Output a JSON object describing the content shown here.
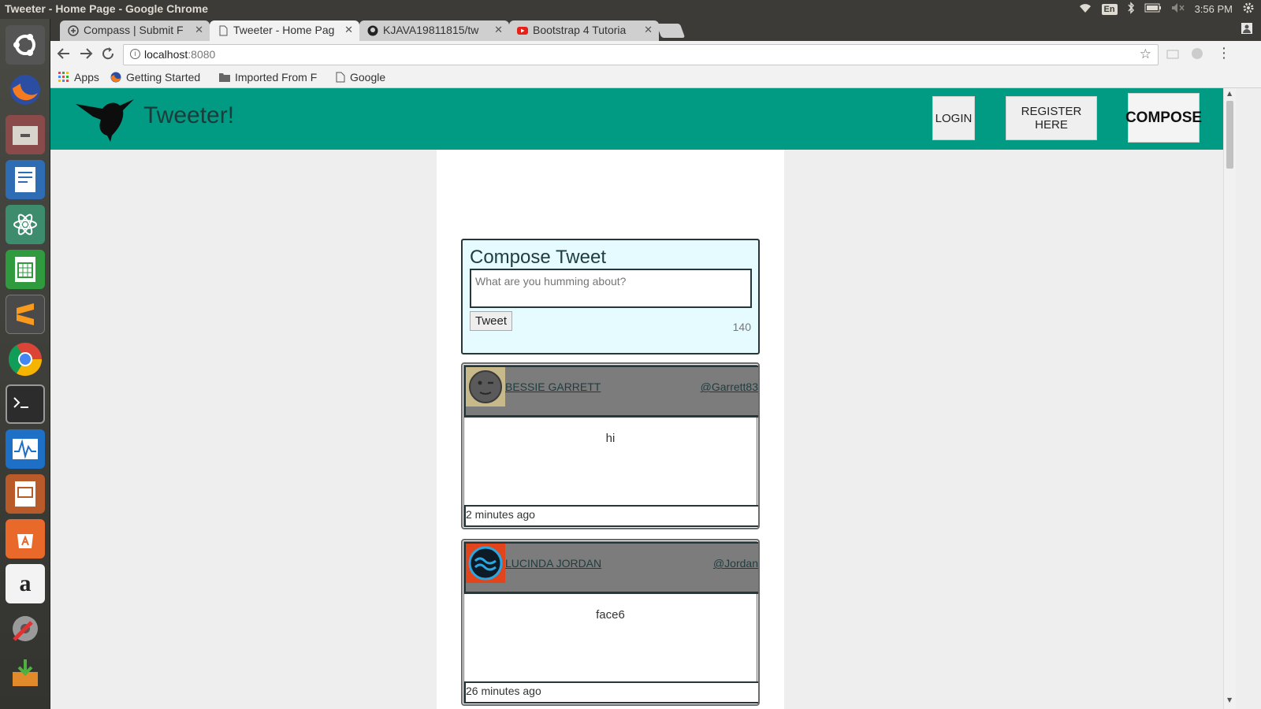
{
  "os": {
    "window_title": "Tweeter - Home Page - Google Chrome",
    "keyboard_layout": "En",
    "clock": "3:56 PM"
  },
  "launcher": {
    "icons": [
      "ubuntu-dash-icon",
      "firefox-icon",
      "files-icon",
      "writer-icon",
      "atom-icon",
      "calc-icon",
      "sublime-icon",
      "chrome-icon",
      "terminal-icon",
      "system-monitor-icon",
      "impress-icon",
      "software-center-icon",
      "amazon-icon",
      "settings-icon",
      "installer-icon"
    ]
  },
  "browser": {
    "tabs": [
      {
        "label": "Compass | Submit F",
        "active": false
      },
      {
        "label": "Tweeter - Home Pag",
        "active": true
      },
      {
        "label": "KJAVA19811815/tw",
        "active": false
      },
      {
        "label": "Bootstrap 4 Tutoria",
        "active": false
      }
    ],
    "url_host": "localhost",
    "url_port": ":8080",
    "bookmarks": [
      "Apps",
      "Getting Started",
      "Imported From F",
      "Google"
    ]
  },
  "page": {
    "brand": "Tweeter!",
    "nav": {
      "login": "LOGIN",
      "register": "REGISTER HERE",
      "compose": "COMPOSE"
    },
    "compose": {
      "title": "Compose Tweet",
      "placeholder": "What are you humming about?",
      "button": "Tweet",
      "counter": "140"
    },
    "tweets": [
      {
        "name": "BESSIE GARRETT",
        "handle": "@Garrett83",
        "text": "hi",
        "time": "2 minutes ago"
      },
      {
        "name": "LUCINDA JORDAN",
        "handle": "@Jordan",
        "text": "face6",
        "time": "26 minutes ago"
      }
    ]
  },
  "colors": {
    "navbar": "#009b82",
    "compose_bg": "#e6fbff",
    "tweet_header": "#7c7c7c"
  }
}
